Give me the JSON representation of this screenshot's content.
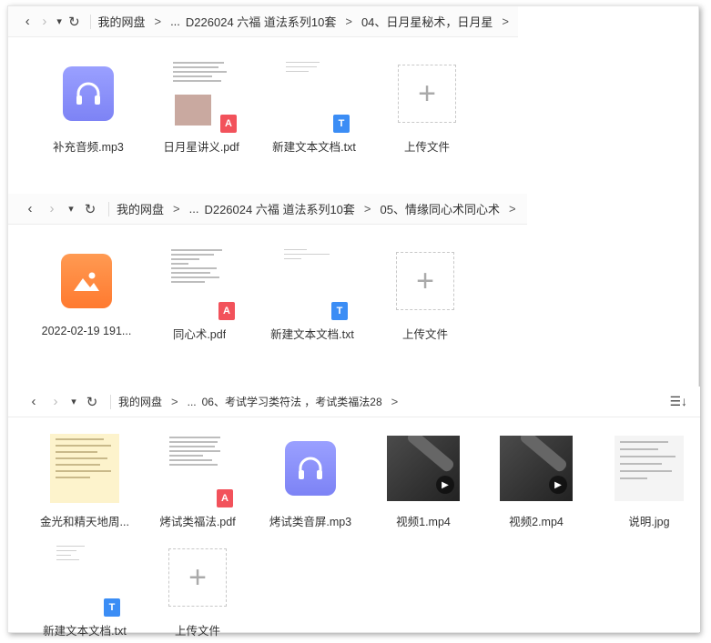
{
  "panels": [
    {
      "breadcrumb": [
        "我的网盘",
        "...",
        "D226024 六福 道法系列10套",
        "04、日月星秘术，日月星"
      ],
      "items": [
        {
          "type": "audio",
          "label": "补充音频.mp3"
        },
        {
          "type": "pdf",
          "label": "日月星讲义.pdf"
        },
        {
          "type": "txt",
          "label": "新建文本文档.txt"
        },
        {
          "type": "upload",
          "label": "上传文件"
        }
      ]
    },
    {
      "breadcrumb": [
        "我的网盘",
        "...",
        "D226024 六福 道法系列10套",
        "05、情缘同心术同心术"
      ],
      "items": [
        {
          "type": "image",
          "label": "2022-02-19 191..."
        },
        {
          "type": "pdf",
          "label": "同心术.pdf"
        },
        {
          "type": "txt",
          "label": "新建文本文档.txt"
        },
        {
          "type": "upload",
          "label": "上传文件"
        }
      ]
    },
    {
      "breadcrumb": [
        "我的网盘",
        "...",
        "06、考试学习类符法 ，考试类福法28"
      ],
      "items": [
        {
          "type": "yellowdoc",
          "label": "金光和精天地周..."
        },
        {
          "type": "pdf",
          "label": "烤试类福法.pdf"
        },
        {
          "type": "audio",
          "label": "烤试类音屏.mp3"
        },
        {
          "type": "video",
          "label": "视频1.mp4"
        },
        {
          "type": "video",
          "label": "视频2.mp4"
        },
        {
          "type": "jpg",
          "label": "说明.jpg"
        },
        {
          "type": "txt",
          "label": "新建文本文档.txt"
        },
        {
          "type": "upload",
          "label": "上传文件"
        }
      ]
    }
  ],
  "icons": {
    "back": "‹",
    "forward": "›",
    "dropdown": "▾",
    "refresh": "↻",
    "sort": "☰↓",
    "upload": "+",
    "pdf_badge": "A",
    "txt_badge": "T",
    "play": "▶"
  },
  "colors": {
    "pdf": "#f2525b",
    "txt": "#3b8df5",
    "audio": "#7d83f5",
    "image": "#ff7a30"
  }
}
